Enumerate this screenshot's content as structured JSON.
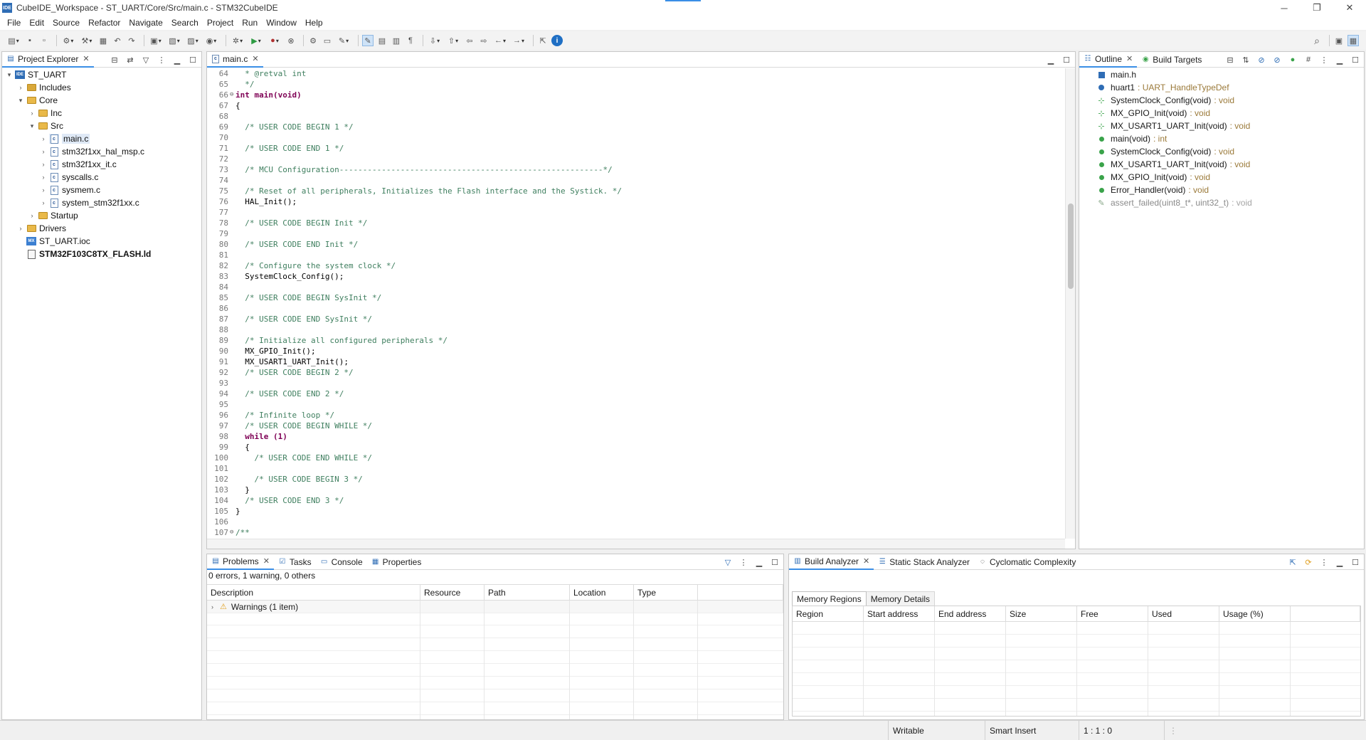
{
  "window": {
    "app_badge": "IDE",
    "title": "CubeIDE_Workspace - ST_UART/Core/Src/main.c - STM32CubeIDE",
    "minimize": "─",
    "restore": "❐",
    "close": "✕"
  },
  "menu": [
    "File",
    "Edit",
    "Source",
    "Refactor",
    "Navigate",
    "Search",
    "Project",
    "Run",
    "Window",
    "Help"
  ],
  "project_explorer": {
    "tab_label": "Project Explorer",
    "tree": [
      {
        "label": "ST_UART",
        "depth": 0,
        "twisty": "▾",
        "icon": "project-icon",
        "bold": false
      },
      {
        "label": "Includes",
        "depth": 1,
        "twisty": "›",
        "icon": "includes-icon"
      },
      {
        "label": "Core",
        "depth": 1,
        "twisty": "▾",
        "icon": "folder-icon"
      },
      {
        "label": "Inc",
        "depth": 2,
        "twisty": "›",
        "icon": "folder-icon"
      },
      {
        "label": "Src",
        "depth": 2,
        "twisty": "▾",
        "icon": "folder-icon"
      },
      {
        "label": "main.c",
        "depth": 3,
        "twisty": "›",
        "icon": "c-file-icon",
        "selected": true
      },
      {
        "label": "stm32f1xx_hal_msp.c",
        "depth": 3,
        "twisty": "›",
        "icon": "c-file-icon"
      },
      {
        "label": "stm32f1xx_it.c",
        "depth": 3,
        "twisty": "›",
        "icon": "c-file-icon"
      },
      {
        "label": "syscalls.c",
        "depth": 3,
        "twisty": "›",
        "icon": "c-file-icon"
      },
      {
        "label": "sysmem.c",
        "depth": 3,
        "twisty": "›",
        "icon": "c-file-icon"
      },
      {
        "label": "system_stm32f1xx.c",
        "depth": 3,
        "twisty": "›",
        "icon": "c-file-icon"
      },
      {
        "label": "Startup",
        "depth": 2,
        "twisty": "›",
        "icon": "folder-icon"
      },
      {
        "label": "Drivers",
        "depth": 1,
        "twisty": "›",
        "icon": "folder-icon"
      },
      {
        "label": "ST_UART.ioc",
        "depth": 1,
        "twisty": "",
        "icon": "mx-file-icon"
      },
      {
        "label": "STM32F103C8TX_FLASH.ld",
        "depth": 1,
        "twisty": "",
        "icon": "ld-file-icon",
        "bold": true
      }
    ]
  },
  "editor": {
    "tab_label": "main.c",
    "lines": [
      {
        "n": "64",
        "fold": "",
        "text": "  * @retval int",
        "cls": "comment"
      },
      {
        "n": "65",
        "fold": "",
        "text": "  */",
        "cls": "comment"
      },
      {
        "n": "66",
        "fold": "⊖",
        "text": "int main(void)",
        "cls": "kw"
      },
      {
        "n": "67",
        "fold": "",
        "text": "{",
        "cls": ""
      },
      {
        "n": "68",
        "fold": "",
        "text": "",
        "cls": ""
      },
      {
        "n": "69",
        "fold": "",
        "text": "  /* USER CODE BEGIN 1 */",
        "cls": "comment"
      },
      {
        "n": "70",
        "fold": "",
        "text": "",
        "cls": ""
      },
      {
        "n": "71",
        "fold": "",
        "text": "  /* USER CODE END 1 */",
        "cls": "comment"
      },
      {
        "n": "72",
        "fold": "",
        "text": "",
        "cls": ""
      },
      {
        "n": "73",
        "fold": "",
        "text": "  /* MCU Configuration--------------------------------------------------------*/",
        "cls": "comment"
      },
      {
        "n": "74",
        "fold": "",
        "text": "",
        "cls": ""
      },
      {
        "n": "75",
        "fold": "",
        "text": "  /* Reset of all peripherals, Initializes the Flash interface and the Systick. */",
        "cls": "comment"
      },
      {
        "n": "76",
        "fold": "",
        "text": "  HAL_Init();",
        "cls": ""
      },
      {
        "n": "77",
        "fold": "",
        "text": "",
        "cls": ""
      },
      {
        "n": "78",
        "fold": "",
        "text": "  /* USER CODE BEGIN Init */",
        "cls": "comment"
      },
      {
        "n": "79",
        "fold": "",
        "text": "",
        "cls": ""
      },
      {
        "n": "80",
        "fold": "",
        "text": "  /* USER CODE END Init */",
        "cls": "comment"
      },
      {
        "n": "81",
        "fold": "",
        "text": "",
        "cls": ""
      },
      {
        "n": "82",
        "fold": "",
        "text": "  /* Configure the system clock */",
        "cls": "comment"
      },
      {
        "n": "83",
        "fold": "",
        "text": "  SystemClock_Config();",
        "cls": ""
      },
      {
        "n": "84",
        "fold": "",
        "text": "",
        "cls": ""
      },
      {
        "n": "85",
        "fold": "",
        "text": "  /* USER CODE BEGIN SysInit */",
        "cls": "comment"
      },
      {
        "n": "86",
        "fold": "",
        "text": "",
        "cls": ""
      },
      {
        "n": "87",
        "fold": "",
        "text": "  /* USER CODE END SysInit */",
        "cls": "comment"
      },
      {
        "n": "88",
        "fold": "",
        "text": "",
        "cls": ""
      },
      {
        "n": "89",
        "fold": "",
        "text": "  /* Initialize all configured peripherals */",
        "cls": "comment"
      },
      {
        "n": "90",
        "fold": "",
        "text": "  MX_GPIO_Init();",
        "cls": ""
      },
      {
        "n": "91",
        "fold": "",
        "text": "  MX_USART1_UART_Init();",
        "cls": ""
      },
      {
        "n": "92",
        "fold": "",
        "text": "  /* USER CODE BEGIN 2 */",
        "cls": "comment"
      },
      {
        "n": "93",
        "fold": "",
        "text": "",
        "cls": ""
      },
      {
        "n": "94",
        "fold": "",
        "text": "  /* USER CODE END 2 */",
        "cls": "comment"
      },
      {
        "n": "95",
        "fold": "",
        "text": "",
        "cls": ""
      },
      {
        "n": "96",
        "fold": "",
        "text": "  /* Infinite loop */",
        "cls": "comment"
      },
      {
        "n": "97",
        "fold": "",
        "text": "  /* USER CODE BEGIN WHILE */",
        "cls": "comment"
      },
      {
        "n": "98",
        "fold": "",
        "text": "  while (1)",
        "cls": "kw"
      },
      {
        "n": "99",
        "fold": "",
        "text": "  {",
        "cls": ""
      },
      {
        "n": "100",
        "fold": "",
        "text": "    /* USER CODE END WHILE */",
        "cls": "comment"
      },
      {
        "n": "101",
        "fold": "",
        "text": "",
        "cls": ""
      },
      {
        "n": "102",
        "fold": "",
        "text": "    /* USER CODE BEGIN 3 */",
        "cls": "comment"
      },
      {
        "n": "103",
        "fold": "",
        "text": "  }",
        "cls": ""
      },
      {
        "n": "104",
        "fold": "",
        "text": "  /* USER CODE END 3 */",
        "cls": "comment"
      },
      {
        "n": "105",
        "fold": "",
        "text": "}",
        "cls": ""
      },
      {
        "n": "106",
        "fold": "",
        "text": "",
        "cls": ""
      },
      {
        "n": "107",
        "fold": "⊖",
        "text": "/**",
        "cls": "comment"
      }
    ]
  },
  "outline": {
    "tab_label": "Outline",
    "build_targets_label": "Build Targets",
    "items": [
      {
        "name": "main.h",
        "type": "",
        "icon": "include-icon"
      },
      {
        "name": "huart1",
        "type": ": UART_HandleTypeDef",
        "icon": "variable-icon"
      },
      {
        "name": "SystemClock_Config(void)",
        "type": ": void",
        "icon": "declaration-icon"
      },
      {
        "name": "MX_GPIO_Init(void)",
        "type": ": void",
        "icon": "static-declaration-icon"
      },
      {
        "name": "MX_USART1_UART_Init(void)",
        "type": ": void",
        "icon": "static-declaration-icon"
      },
      {
        "name": "main(void)",
        "type": ": int",
        "icon": "function-icon"
      },
      {
        "name": "SystemClock_Config(void)",
        "type": ": void",
        "icon": "function-icon"
      },
      {
        "name": "MX_USART1_UART_Init(void)",
        "type": ": void",
        "icon": "static-function-icon"
      },
      {
        "name": "MX_GPIO_Init(void)",
        "type": ": void",
        "icon": "static-function-icon"
      },
      {
        "name": "Error_Handler(void)",
        "type": ": void",
        "icon": "function-icon"
      },
      {
        "name": "assert_failed(uint8_t*, uint32_t)",
        "type": ": void",
        "icon": "inactive-function-icon",
        "dim": true
      }
    ]
  },
  "problems": {
    "tabs": [
      "Problems",
      "Tasks",
      "Console",
      "Properties"
    ],
    "summary": "0 errors, 1 warning, 0 others",
    "columns": [
      "Description",
      "Resource",
      "Path",
      "Location",
      "Type"
    ],
    "rows": [
      {
        "description": "Warnings (1 item)"
      }
    ]
  },
  "build_analyzer": {
    "tabs": [
      "Build Analyzer",
      "Static Stack Analyzer",
      "Cyclomatic Complexity"
    ],
    "subtabs": [
      "Memory Regions",
      "Memory Details"
    ],
    "columns": [
      "Region",
      "Start address",
      "End address",
      "Size",
      "Free",
      "Used",
      "Usage (%)"
    ]
  },
  "status": {
    "writable": "Writable",
    "insert_mode": "Smart Insert",
    "position": "1 : 1 : 0"
  }
}
